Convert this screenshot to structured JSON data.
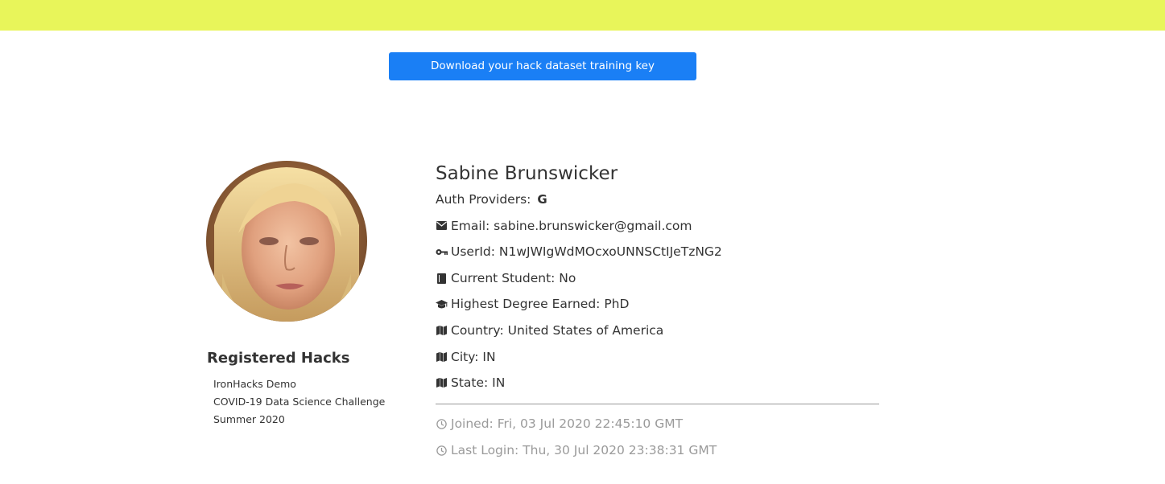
{
  "header": {
    "bar_color": "#e8f55a"
  },
  "actions": {
    "download_label": "Download your hack dataset training key",
    "button_color": "#1a7ff5"
  },
  "avatar": {
    "alt": "Profile photo"
  },
  "hacks": {
    "title": "Registered Hacks",
    "items": [
      "IronHacks Demo",
      "COVID-19 Data Science Challenge",
      "Summer 2020"
    ]
  },
  "profile": {
    "name": "Sabine Brunswicker",
    "auth_label": "Auth Providers:",
    "auth_provider_icon": "google-icon",
    "auth_provider_glyph": "G",
    "fields": [
      {
        "icon": "envelope-icon",
        "text": "Email: sabine.brunswicker@gmail.com"
      },
      {
        "icon": "key-icon",
        "text": "UserId: N1wJWIgWdMOcxoUNNSCtIJeTzNG2"
      },
      {
        "icon": "book-icon",
        "text": "Current Student: No"
      },
      {
        "icon": "graduation-cap-icon",
        "text": "Highest Degree Earned: PhD"
      },
      {
        "icon": "map-icon",
        "text": "Country: United States of America"
      },
      {
        "icon": "map-icon",
        "text": "City: IN"
      },
      {
        "icon": "map-icon",
        "text": "State: IN"
      }
    ],
    "joined": "Joined: Fri, 03 Jul 2020 22:45:10 GMT",
    "last_login": "Last Login: Thu, 30 Jul 2020 23:38:31 GMT"
  }
}
